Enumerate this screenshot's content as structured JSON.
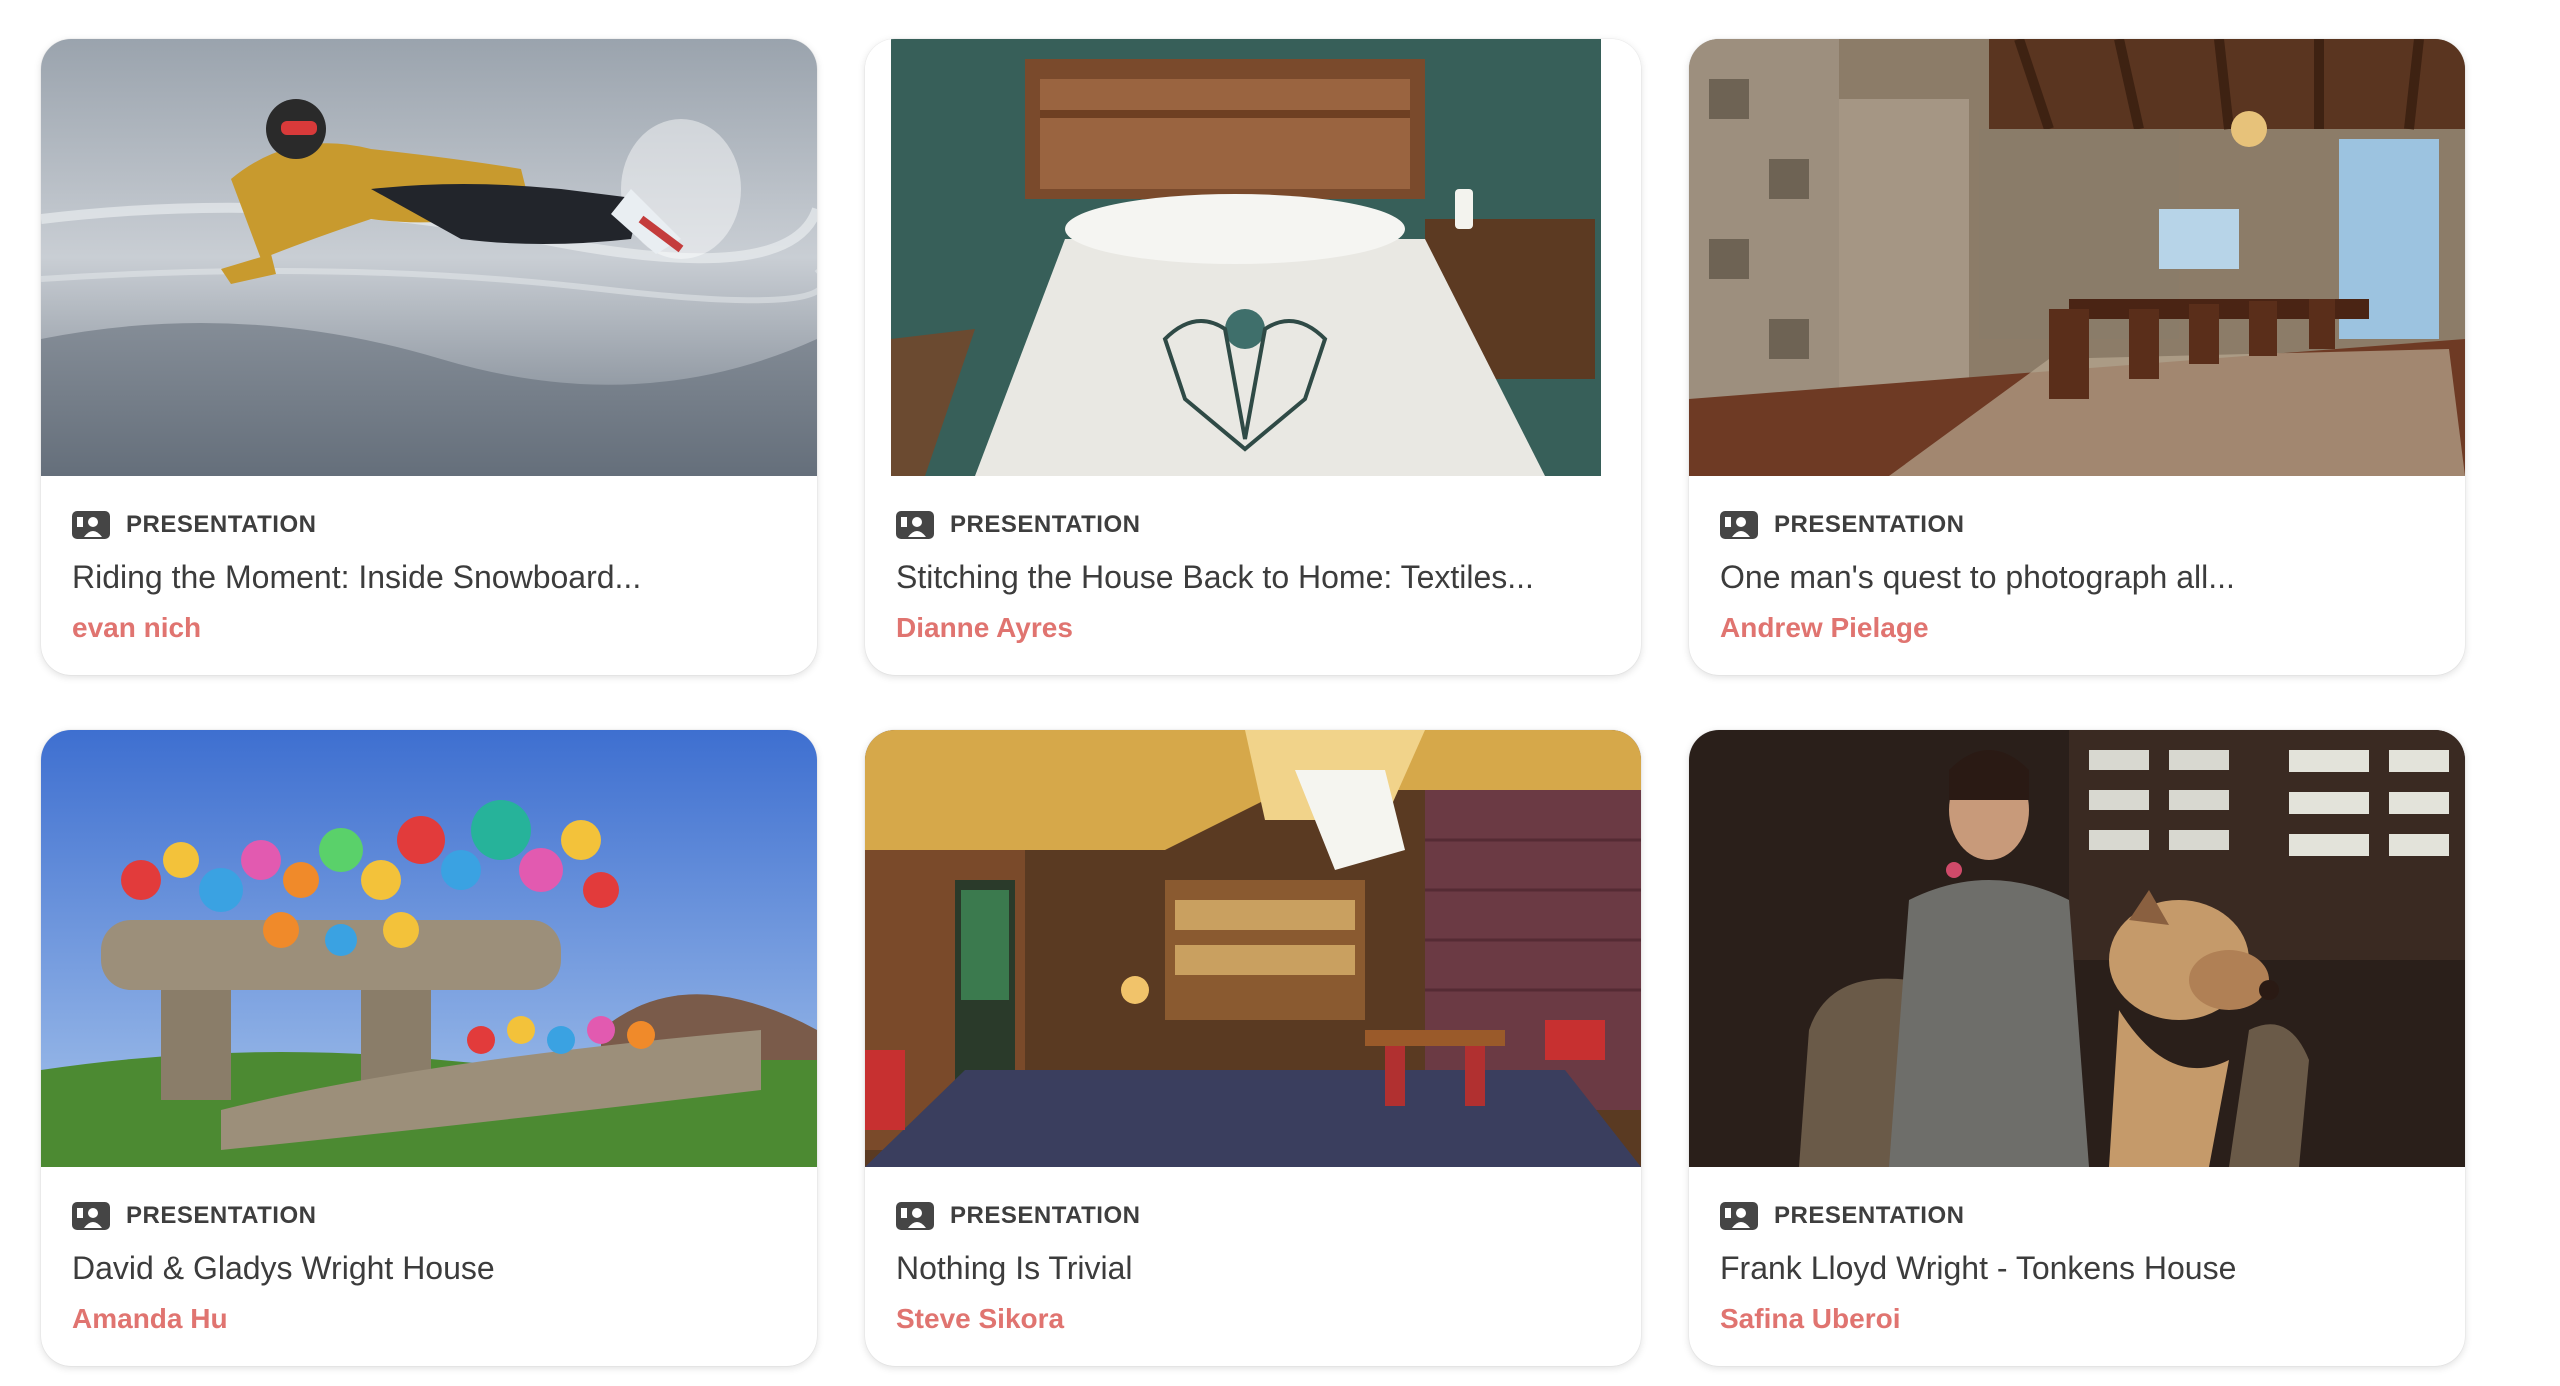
{
  "colors": {
    "accent": "#e07470",
    "label": "#3e3e3e",
    "title": "#3c3c3c",
    "background": "#ffffff"
  },
  "cards": [
    {
      "type_icon": "presentation-icon",
      "type_label": "PRESENTATION",
      "title": "Riding the Moment: Inside Snowboard...",
      "author": "evan nich",
      "image": "snowboarder-on-ice-photo"
    },
    {
      "type_icon": "presentation-icon",
      "type_label": "PRESENTATION",
      "title": "Stitching the House Back to Home: Textiles...",
      "author": "Dianne Ayres",
      "image": "embroidered-bed-photo"
    },
    {
      "type_icon": "presentation-icon",
      "type_label": "PRESENTATION",
      "title": "One man's quest to photograph all...",
      "author": "Andrew Pielage",
      "image": "textile-block-interior-photo"
    },
    {
      "type_icon": "presentation-icon",
      "type_label": "PRESENTATION",
      "title": "David & Gladys Wright House",
      "author": "Amanda Hu",
      "image": "balloon-house-photo"
    },
    {
      "type_icon": "presentation-icon",
      "type_label": "PRESENTATION",
      "title": "Nothing Is Trivial",
      "author": "Steve Sikora",
      "image": "wood-brick-interior-photo"
    },
    {
      "type_icon": "presentation-icon",
      "type_label": "PRESENTATION",
      "title": "Frank Lloyd Wright - Tonkens House",
      "author": "Safina Uberoi",
      "image": "woman-with-dog-photo"
    }
  ]
}
